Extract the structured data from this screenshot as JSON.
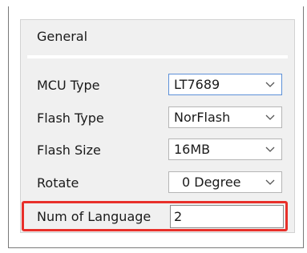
{
  "general": {
    "title": "General",
    "mcu_type": {
      "label": "MCU Type",
      "value": "LT7689"
    },
    "flash_type": {
      "label": "Flash Type",
      "value": "NorFlash"
    },
    "flash_size": {
      "label": "Flash Size",
      "value": "16MB"
    },
    "rotate": {
      "label": "Rotate",
      "value": "0 Degree"
    },
    "num_language": {
      "label": "Num of Language",
      "value": "2"
    }
  },
  "colors": {
    "highlight": "#e8302a",
    "panel": "#f0f0f0"
  },
  "icons": {
    "dropdown": "chevron-down-icon"
  }
}
